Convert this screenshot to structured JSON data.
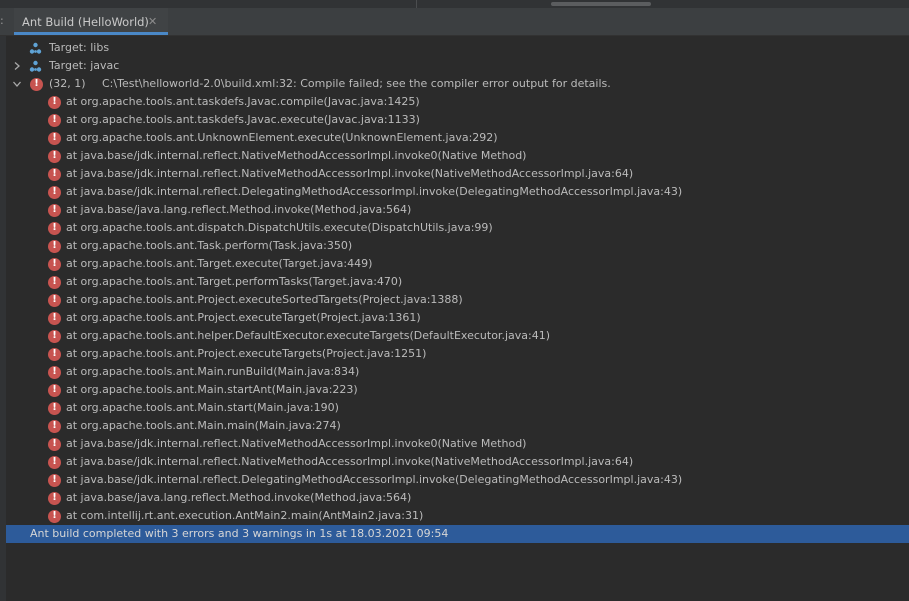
{
  "tab": {
    "title": "Ant Build (HelloWorld)",
    "close_glyph": "✕"
  },
  "targets": [
    {
      "label": "Target: libs",
      "icon": "ant-target-icon",
      "expandable": false
    },
    {
      "label": "Target: javac",
      "icon": "ant-target-icon",
      "expandable": true
    }
  ],
  "error": {
    "location": "(32, 1)",
    "message": "C:\\Test\\helloworld-2.0\\build.xml:32: Compile failed; see the compiler error output for details.",
    "icon": "error-icon"
  },
  "stack_trace": [
    "at org.apache.tools.ant.taskdefs.Javac.compile(Javac.java:1425)",
    "at org.apache.tools.ant.taskdefs.Javac.execute(Javac.java:1133)",
    "at org.apache.tools.ant.UnknownElement.execute(UnknownElement.java:292)",
    "at java.base/jdk.internal.reflect.NativeMethodAccessorImpl.invoke0(Native Method)",
    "at java.base/jdk.internal.reflect.NativeMethodAccessorImpl.invoke(NativeMethodAccessorImpl.java:64)",
    "at java.base/jdk.internal.reflect.DelegatingMethodAccessorImpl.invoke(DelegatingMethodAccessorImpl.java:43)",
    "at java.base/java.lang.reflect.Method.invoke(Method.java:564)",
    "at org.apache.tools.ant.dispatch.DispatchUtils.execute(DispatchUtils.java:99)",
    "at org.apache.tools.ant.Task.perform(Task.java:350)",
    "at org.apache.tools.ant.Target.execute(Target.java:449)",
    "at org.apache.tools.ant.Target.performTasks(Target.java:470)",
    "at org.apache.tools.ant.Project.executeSortedTargets(Project.java:1388)",
    "at org.apache.tools.ant.Project.executeTarget(Project.java:1361)",
    "at org.apache.tools.ant.helper.DefaultExecutor.executeTargets(DefaultExecutor.java:41)",
    "at org.apache.tools.ant.Project.executeTargets(Project.java:1251)",
    "at org.apache.tools.ant.Main.runBuild(Main.java:834)",
    "at org.apache.tools.ant.Main.startAnt(Main.java:223)",
    "at org.apache.tools.ant.Main.start(Main.java:190)",
    "at org.apache.tools.ant.Main.main(Main.java:274)",
    "at java.base/jdk.internal.reflect.NativeMethodAccessorImpl.invoke0(Native Method)",
    "at java.base/jdk.internal.reflect.NativeMethodAccessorImpl.invoke(NativeMethodAccessorImpl.java:64)",
    "at java.base/jdk.internal.reflect.DelegatingMethodAccessorImpl.invoke(DelegatingMethodAccessorImpl.java:43)",
    "at java.base/java.lang.reflect.Method.invoke(Method.java:564)",
    "at com.intellij.rt.ant.execution.AntMain2.main(AntMain2.java:31)"
  ],
  "status": {
    "text": "Ant build completed with 3 errors and 3 warnings in 1s at 18.03.2021 09:54"
  },
  "colors": {
    "background": "#2b2b2b",
    "text": "#bbbbbb",
    "error": "#c75450",
    "selection": "#2d5b9a",
    "tab_underline": "#4a88c7",
    "ant_icon": "#5fa3d6"
  }
}
